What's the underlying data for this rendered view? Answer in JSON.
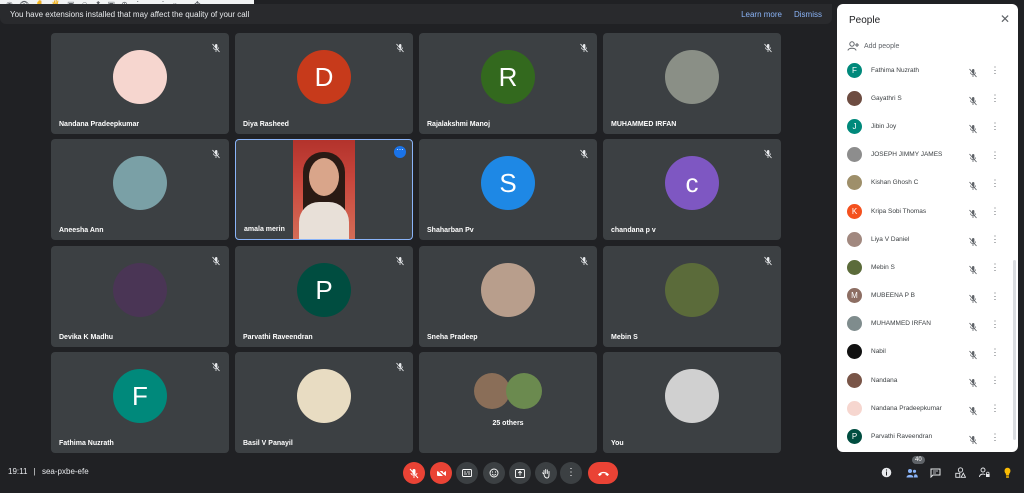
{
  "banner": {
    "message": "You have extensions installed that may affect the quality of your call",
    "learn_more": "Learn more",
    "dismiss": "Dismiss"
  },
  "tiles": [
    {
      "name": "Nandana Pradeepkumar",
      "initial": "",
      "color": "#f6d6cf"
    },
    {
      "name": "Diya Rasheed",
      "initial": "D",
      "color": "#c73a1b"
    },
    {
      "name": "Rajalakshmi Manoj",
      "initial": "R",
      "color": "#33691e"
    },
    {
      "name": "MUHAMMED IRFAN",
      "initial": "",
      "color": "#8a8f86"
    },
    {
      "name": "Aneesha Ann",
      "initial": "",
      "color": "#7aa0a6"
    },
    {
      "name": "amala merin",
      "initial": "",
      "color": "#b3332c"
    },
    {
      "name": "Shaharban Pv",
      "initial": "S",
      "color": "#1e88e5"
    },
    {
      "name": "chandana p v",
      "initial": "c",
      "color": "#7e57c2"
    },
    {
      "name": "Devika K Madhu",
      "initial": "",
      "color": "#4a3555"
    },
    {
      "name": "Parvathi Raveendran",
      "initial": "P",
      "color": "#004d40"
    },
    {
      "name": "Sneha Pradeep",
      "initial": "",
      "color": "#b89e8c"
    },
    {
      "name": "Mebin S",
      "initial": "",
      "color": "#5b6b3a"
    },
    {
      "name": "Fathima Nuzrath",
      "initial": "F",
      "color": "#00897b"
    },
    {
      "name": "Basil V Panayil",
      "initial": "",
      "color": "#e8dcc2"
    },
    {
      "name": "",
      "initial": "",
      "color": "#3c4043"
    },
    {
      "name": "You",
      "initial": "",
      "color": "#d0d0d0"
    }
  ],
  "others_label": "25 others",
  "people_panel": {
    "title": "People",
    "add_people": "Add people",
    "participants": [
      {
        "name": "Fathima Nuzrath",
        "initial": "F",
        "color": "#00897b"
      },
      {
        "name": "Gayathri S",
        "initial": "",
        "color": "#6d4c41"
      },
      {
        "name": "Jibin Joy",
        "initial": "J",
        "color": "#00897b"
      },
      {
        "name": "JOSEPH JIMMY JAMES",
        "initial": "",
        "color": "#8d8d8d"
      },
      {
        "name": "Kishan Ghosh C",
        "initial": "",
        "color": "#9e8f6a"
      },
      {
        "name": "Kripa Sobi Thomas",
        "initial": "K",
        "color": "#f4511e"
      },
      {
        "name": "Liya V Daniel",
        "initial": "",
        "color": "#a1887f"
      },
      {
        "name": "Mebin S",
        "initial": "",
        "color": "#5b6b3a"
      },
      {
        "name": "MUBEENA P B",
        "initial": "M",
        "color": "#8d6e63"
      },
      {
        "name": "MUHAMMED IRFAN",
        "initial": "",
        "color": "#7f8c8d"
      },
      {
        "name": "Nabil",
        "initial": "",
        "color": "#111111"
      },
      {
        "name": "Nandana",
        "initial": "",
        "color": "#795548"
      },
      {
        "name": "Nandana Pradeepkumar",
        "initial": "",
        "color": "#f6d6cf"
      },
      {
        "name": "Parvathi Raveendran",
        "initial": "P",
        "color": "#004d40"
      }
    ]
  },
  "meeting": {
    "time": "19:11",
    "separator": "|",
    "code": "sea-pxbe-efe"
  },
  "participant_count": "40",
  "ext_icons": [
    "◉",
    "👁",
    "✋",
    "🖐",
    "▣",
    "☺",
    "⬆",
    "▣",
    "⊕",
    "⋮",
    "⌣",
    "⋮",
    "»",
    "–",
    "✥"
  ]
}
